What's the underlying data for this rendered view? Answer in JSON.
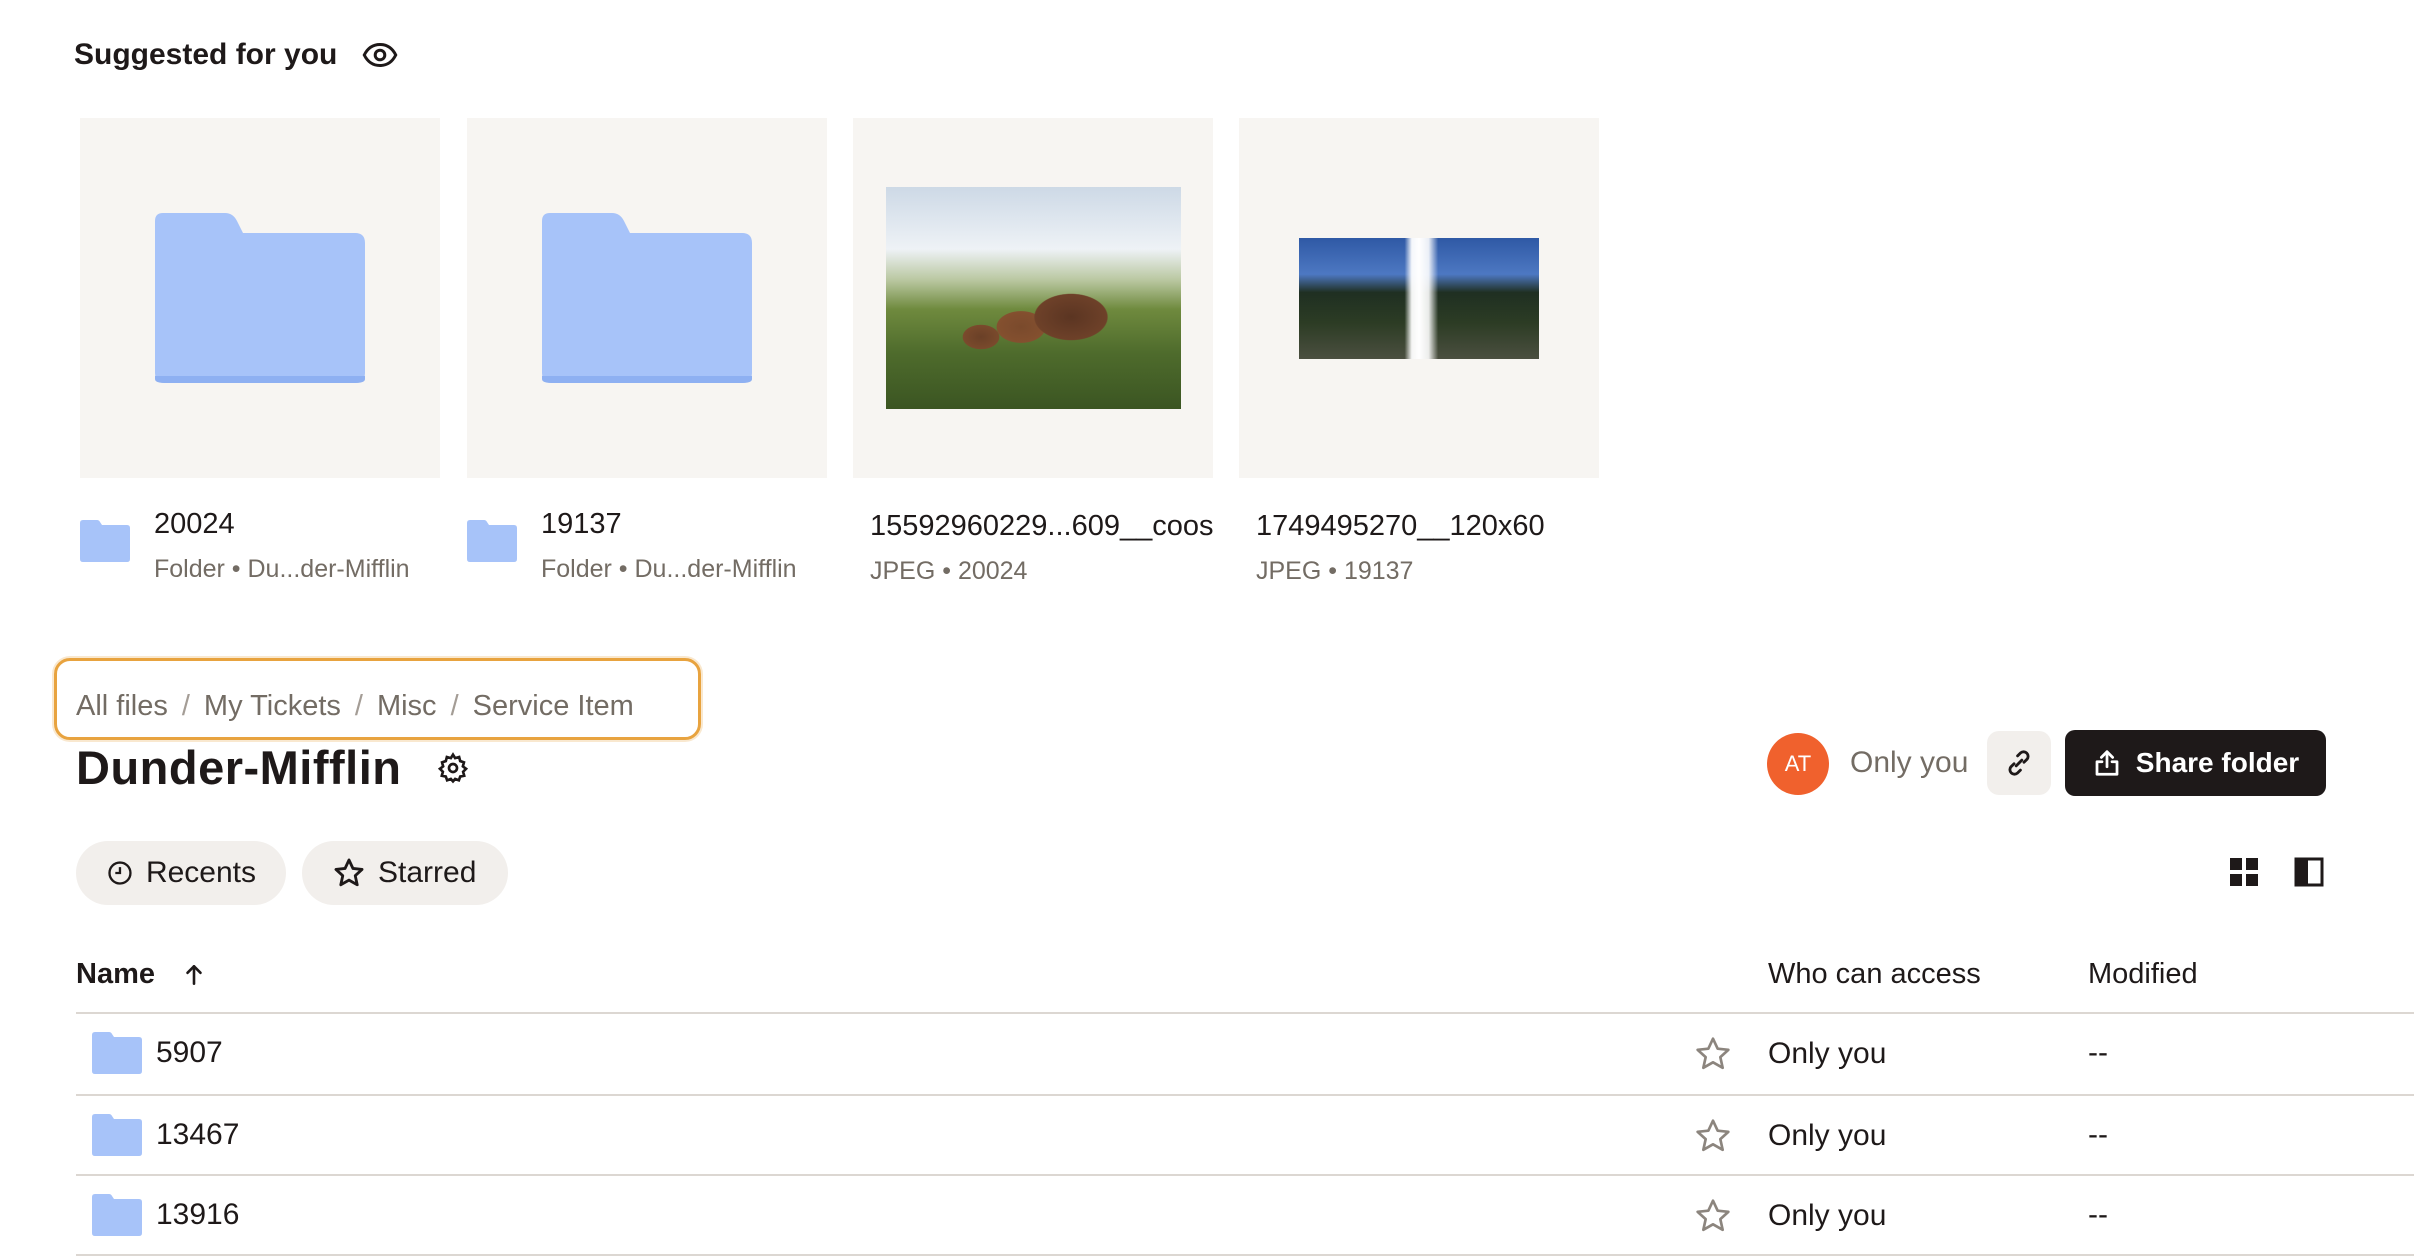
{
  "suggested": {
    "title": "Suggested for you",
    "cards": [
      {
        "type": "folder",
        "name": "20024",
        "subtitle": "Folder • Du...der-Mifflin"
      },
      {
        "type": "folder",
        "name": "19137",
        "subtitle": "Folder • Du...der-Mifflin"
      },
      {
        "type": "image",
        "name": "15592960229...609__coos",
        "subtitle": "JPEG • 20024"
      },
      {
        "type": "image",
        "name": "1749495270__120x60",
        "subtitle": "JPEG • 19137"
      }
    ]
  },
  "breadcrumb": {
    "items": [
      "All files",
      "My Tickets",
      "Misc",
      "Service Item"
    ],
    "separator": "/"
  },
  "folder": {
    "title": "Dunder-Mifflin",
    "owner_initials": "AT",
    "access_label": "Only you",
    "share_label": "Share folder"
  },
  "filters": {
    "recents": "Recents",
    "starred": "Starred"
  },
  "table": {
    "headers": {
      "name": "Name",
      "access": "Who can access",
      "modified": "Modified"
    },
    "rows": [
      {
        "name": "5907",
        "access": "Only you",
        "modified": "--"
      },
      {
        "name": "13467",
        "access": "Only you",
        "modified": "--"
      },
      {
        "name": "13916",
        "access": "Only you",
        "modified": "--"
      }
    ]
  },
  "colors": {
    "folder": "#a7c3f9",
    "avatar": "#f0612d",
    "highlight": "#e8a33f",
    "primary_button": "#1e1919"
  }
}
